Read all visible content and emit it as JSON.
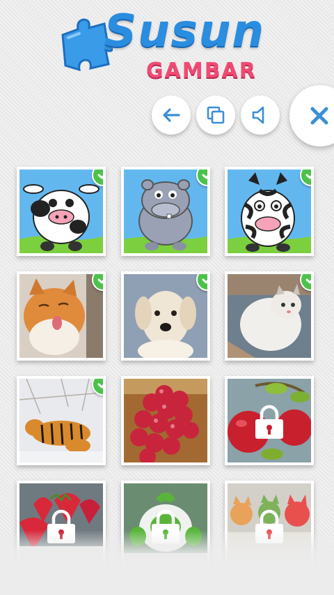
{
  "logo": {
    "title": "Susun",
    "subtitle": "GAMBAR"
  },
  "toolbar": {
    "back_icon": "arrow-left-icon",
    "copy_icon": "copy-windows-icon",
    "sound_icon": "speaker-icon",
    "close_icon": "close-x-icon"
  },
  "colors": {
    "accent_blue": "#2a8de0",
    "accent_pink": "#f04a74",
    "check_green": "#4cc24a"
  },
  "puzzles": [
    {
      "subject": "cartoon-cow",
      "completed": true,
      "locked": false
    },
    {
      "subject": "cartoon-hippo",
      "completed": true,
      "locked": false
    },
    {
      "subject": "cartoon-zebra",
      "completed": true,
      "locked": false
    },
    {
      "subject": "orange-cat",
      "completed": true,
      "locked": false
    },
    {
      "subject": "puppy",
      "completed": true,
      "locked": false
    },
    {
      "subject": "white-kitten",
      "completed": true,
      "locked": false
    },
    {
      "subject": "tigers-in-snow",
      "completed": true,
      "locked": false
    },
    {
      "subject": "red-grapes",
      "completed": false,
      "locked": false
    },
    {
      "subject": "red-apples",
      "completed": false,
      "locked": true
    },
    {
      "subject": "strawberries",
      "completed": false,
      "locked": true
    },
    {
      "subject": "green-toy",
      "completed": false,
      "locked": true
    },
    {
      "subject": "toy-cats",
      "completed": false,
      "locked": true
    }
  ]
}
